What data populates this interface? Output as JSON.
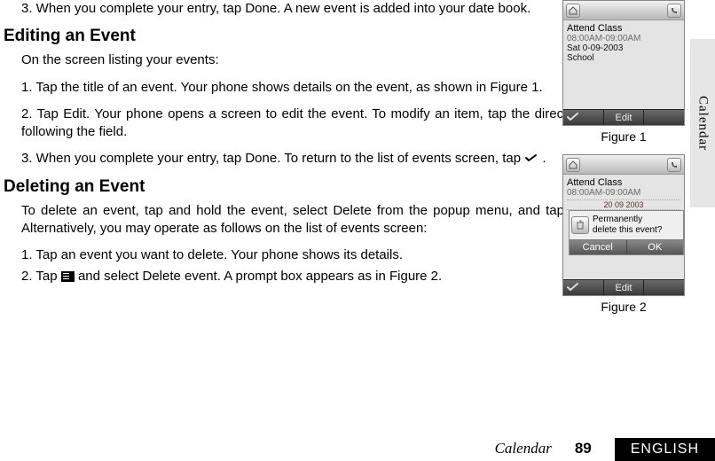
{
  "sidetab": "Calendar",
  "body": {
    "p1": "3. When you complete your entry, tap Done. A new event is added into your date book.",
    "h_edit": "Editing an Event",
    "p2": "On the screen listing your events:",
    "p3": "1. Tap the title of an event. Your phone shows details on the event, as shown in Figure 1.",
    "p4": "2. Tap Edit. Your phone opens a screen to edit the event. To modify an item, tap the direct line following the field.",
    "p5a": "3. When you complete your entry, tap Done. To return to the list of events screen, tap ",
    "p5b": " .",
    "h_del": "Deleting an Event",
    "p6": "To delete an event, tap and hold the event, select Delete from the popup menu, and tap OK. Alternatively, you may operate as follows on the list of events screen:",
    "p7": "1. Tap an event you want to delete. Your phone shows its details.",
    "p8a": "2. Tap ",
    "p8b": " and select Delete event. A prompt box appears as in Figure 2."
  },
  "figure1": {
    "event_title": "Attend Class",
    "event_time": "08:00AM-09:00AM",
    "event_date": "Sat 0-09-2003",
    "event_loc": "School",
    "soft_center": "Edit",
    "caption": "Figure 1"
  },
  "figure2": {
    "event_title": "Attend Class",
    "event_time": "08:00AM-09:00AM",
    "mid_date": "20 09 2003",
    "popup_line1": "Permanently",
    "popup_line2": "delete this event?",
    "popup_cancel": "Cancel",
    "popup_ok": "OK",
    "soft_center": "Edit",
    "caption": "Figure 2"
  },
  "footer": {
    "section": "Calendar",
    "page": "89",
    "lang": "ENGLISH"
  }
}
